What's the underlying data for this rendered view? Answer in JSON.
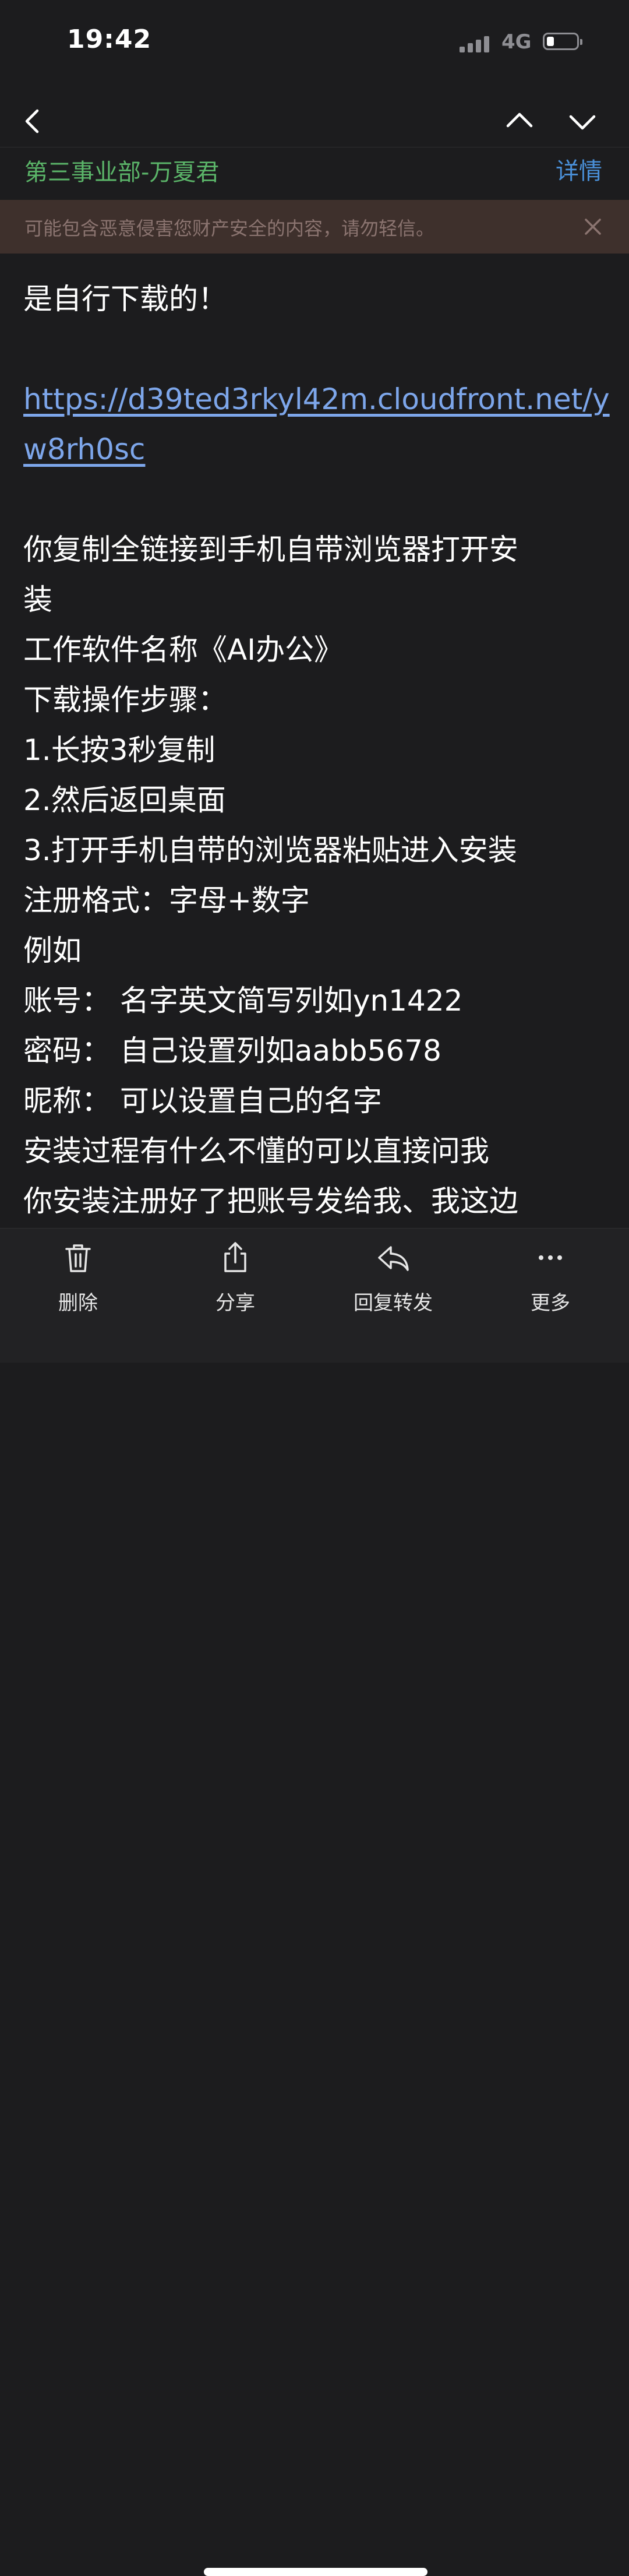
{
  "status_bar": {
    "time": "19:42",
    "network": "4G"
  },
  "sender": {
    "name": "第三事业部-万夏君",
    "details_label": "详情"
  },
  "warning": {
    "text": "可能包含恶意侵害您财产安全的内容，请勿轻信。"
  },
  "message": {
    "lines": [
      "是自行下载的！",
      "",
      "https://d39ted3rkyl42m.cloudfront.net/y",
      "w8rh0sc",
      "",
      "你复制全链接到手机自带浏览器打开安",
      "装",
      "工作软件名称《AI办公》",
      "下载操作步骤：",
      "1.长按3秒复制",
      "2.然后返回桌面",
      "3.打开手机自带的浏览器粘贴进入安装",
      "注册格式：字母+数字",
      "例如",
      "账号：  名字英文简写列如yn1422",
      "密码：  自己设置列如aabb5678",
      "昵称：  可以设置自己的名字",
      "安装过程有什么不懂的可以直接问我",
      "你安装注册好了把账号发给我、我这边"
    ]
  },
  "toolbar": {
    "delete_label": "删除",
    "share_label": "分享",
    "reply_forward_label": "回复转发",
    "more_label": "更多"
  },
  "icons": {
    "back": "chevron-left-icon",
    "prev": "chevron-up-icon",
    "next": "chevron-down-icon",
    "close": "close-icon",
    "delete": "trash-icon",
    "share": "share-icon",
    "reply": "reply-icon",
    "more": "more-icon"
  },
  "colors": {
    "background": "#1c1c1e",
    "sender": "#5bb569",
    "details": "#4a90d9",
    "warning_bg": "#3e302c",
    "warning_text": "#8b7470",
    "link": "#7da6ea"
  }
}
